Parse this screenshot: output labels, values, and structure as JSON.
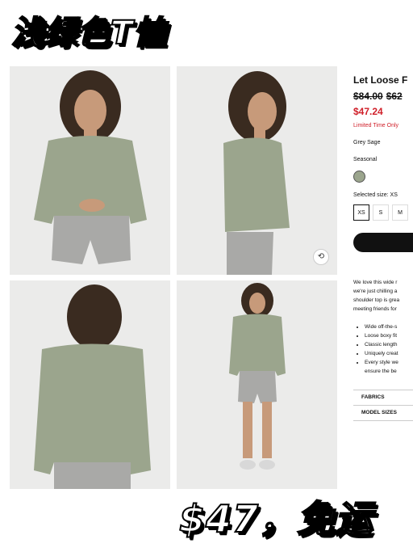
{
  "banner": {
    "top": "浅绿色T恤",
    "bottom": "$47，免运"
  },
  "product": {
    "title": "Let Loose F",
    "price_original_1": "$84.00",
    "price_original_2": "$62",
    "price_sale": "$47.24",
    "limited": "Limited Time Only",
    "color_name": "Grey Sage",
    "collection": "Seasonal",
    "selected_size_label": "Selected size: XS",
    "sizes": [
      "XS",
      "S",
      "M"
    ],
    "description": [
      "We love this wide r",
      "we're just chilling a",
      "shoulder top is grea",
      "meeting friends for"
    ],
    "features": [
      "Wide off-the-s",
      "Loose boxy fit",
      "Classic length",
      "Uniquely creat",
      "Every style we",
      "ensure the be"
    ],
    "accordions": [
      "FABRICS",
      "MODEL SIZES"
    ]
  },
  "colors": {
    "shirt": "#9ba58d",
    "shorts": "#a9a9a7",
    "sale_red": "#d0202a"
  },
  "icons": [
    "rotate-icon"
  ]
}
